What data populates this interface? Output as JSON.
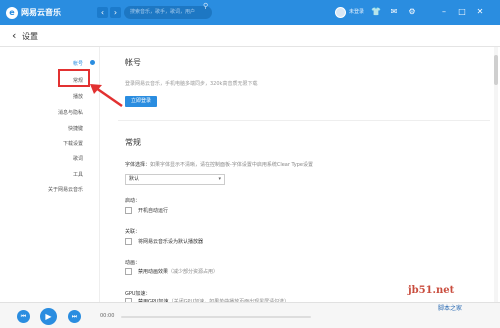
{
  "app": {
    "logo_glyph": "e",
    "name": "网易云音乐",
    "brand_color": "#2a8de0"
  },
  "topbar": {
    "back_glyph": "‹",
    "forward_glyph": "›",
    "search_placeholder": "搜索音乐，歌手，歌词，用户",
    "search_icon": "search-icon",
    "username": "未登录",
    "icons": [
      "skin-icon",
      "mail-icon",
      "settings-icon",
      "minimize-icon",
      "maximize-icon",
      "close-icon"
    ]
  },
  "page": {
    "back_glyph": "‹",
    "title": "设置"
  },
  "sidebar": {
    "items": [
      {
        "label": "帐号",
        "active": true
      },
      {
        "label": "常规",
        "active": false
      },
      {
        "label": "播放",
        "active": false
      },
      {
        "label": "消息与隐私",
        "active": false
      },
      {
        "label": "快捷键",
        "active": false
      },
      {
        "label": "下载设置",
        "active": false
      },
      {
        "label": "歌词",
        "active": false
      },
      {
        "label": "工具",
        "active": false
      },
      {
        "label": "关于网易云音乐",
        "active": false
      }
    ]
  },
  "account": {
    "title": "帐号",
    "desc": "登录网易云音乐，手机电脑多端同步，320k高音质无限下载",
    "login_button": "立即登录"
  },
  "general": {
    "title": "常规",
    "font_label": "字体选择：",
    "font_hint": "如果字体显示不清晰，请在控制面板-字体设置中启用系统Clear Type设置",
    "font_value": "默认",
    "startup_label": "启动：",
    "startup_option": "开机自动运行",
    "assoc_label": "关联：",
    "assoc_option": "将网易云音乐设为默认播放器",
    "anim_label": "动画：",
    "anim_option": "禁用动画效果",
    "anim_hint": "（减少部分资源占用）",
    "gpu_label": "GPU加速：",
    "gpu_option": "禁用GPU加速",
    "gpu_hint": "（关闭GPU加速，如果单曲播放页面出现黑屏请勾选）"
  },
  "player": {
    "prev_glyph": "⏮",
    "play_glyph": "▶",
    "next_glyph": "⏭",
    "time_current": "00:00",
    "progress": 0
  },
  "watermark": {
    "line1": "jb51.net",
    "line2": "脚本之家"
  }
}
